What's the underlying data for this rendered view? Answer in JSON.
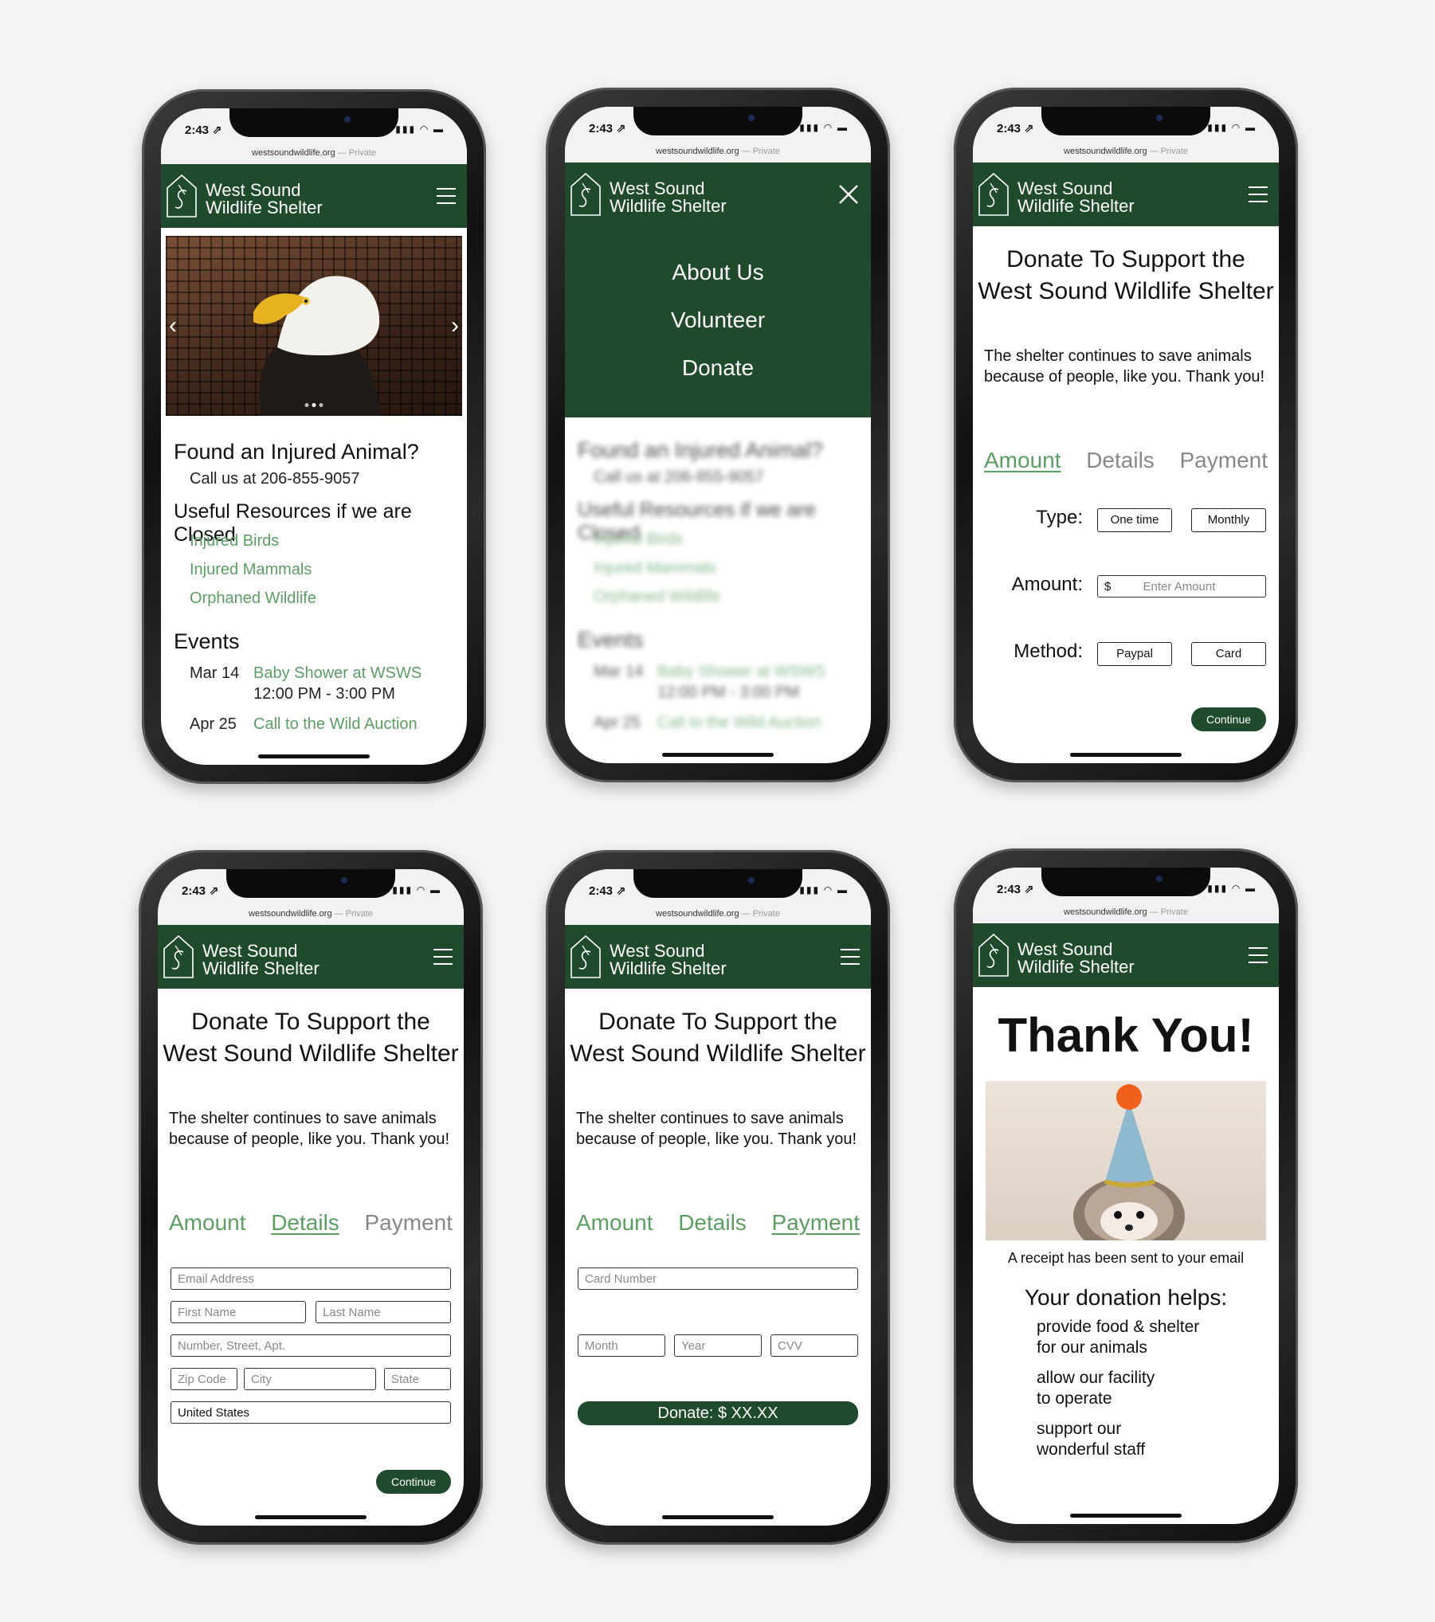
{
  "status": {
    "time": "2:43 ⇗",
    "icons": "▮▮▮ ◠ ▬"
  },
  "url": {
    "domain": "westsoundwildlife.org",
    "private": " — Private"
  },
  "brand": {
    "line1": "West Sound",
    "line2": "Wildlife Shelter"
  },
  "home": {
    "found_title": "Found an Injured Animal?",
    "call_text": "Call us at 206-855-9057",
    "resources_title": "Useful Resources if we are Closed",
    "resources": [
      "Injured Birds",
      "Injured Mammals",
      "Orphaned Wildlife"
    ],
    "events_title": "Events",
    "events": [
      {
        "date": "Mar 14",
        "name": "Baby Shower at WSWS",
        "time": "12:00 PM - 3:00 PM"
      },
      {
        "date": "Apr 25",
        "name": "Call to the Wild Auction",
        "time": ""
      }
    ]
  },
  "menu": {
    "items": [
      "About Us",
      "Volunteer",
      "Donate"
    ]
  },
  "donate": {
    "title1": "Donate To Support the",
    "title2": "West Sound Wildlife Shelter",
    "lead": "The shelter continues to save animals because of people, like you. Thank you!",
    "tabs": [
      "Amount",
      "Details",
      "Payment"
    ],
    "amount": {
      "type_label": "Type:",
      "type_options": [
        "One time",
        "Monthly"
      ],
      "amount_label": "Amount:",
      "currency": "$",
      "amount_placeholder": "Enter Amount",
      "method_label": "Method:",
      "method_options": [
        "Paypal",
        "Card"
      ],
      "continue": "Continue"
    },
    "details": {
      "email": "Email Address",
      "first": "First Name",
      "last": "Last Name",
      "street": "Number, Street, Apt.",
      "zip": "Zip Code",
      "city": "City",
      "state": "State",
      "country": "United States",
      "continue": "Continue"
    },
    "payment": {
      "card": "Card Number",
      "month": "Month",
      "year": "Year",
      "cvv": "CVV",
      "donate": "Donate: $ XX.XX"
    }
  },
  "thanks": {
    "title": "Thank You!",
    "receipt": "A receipt has been sent to your email",
    "helps_title": "Your donation helps:",
    "helps": [
      [
        "provide food & shelter",
        "for our animals"
      ],
      [
        "allow our facility",
        "to operate"
      ],
      [
        "support our",
        "wonderful staff"
      ]
    ]
  },
  "colors": {
    "brand_green": "#1f4a2c",
    "link_green": "#5a9e62"
  }
}
